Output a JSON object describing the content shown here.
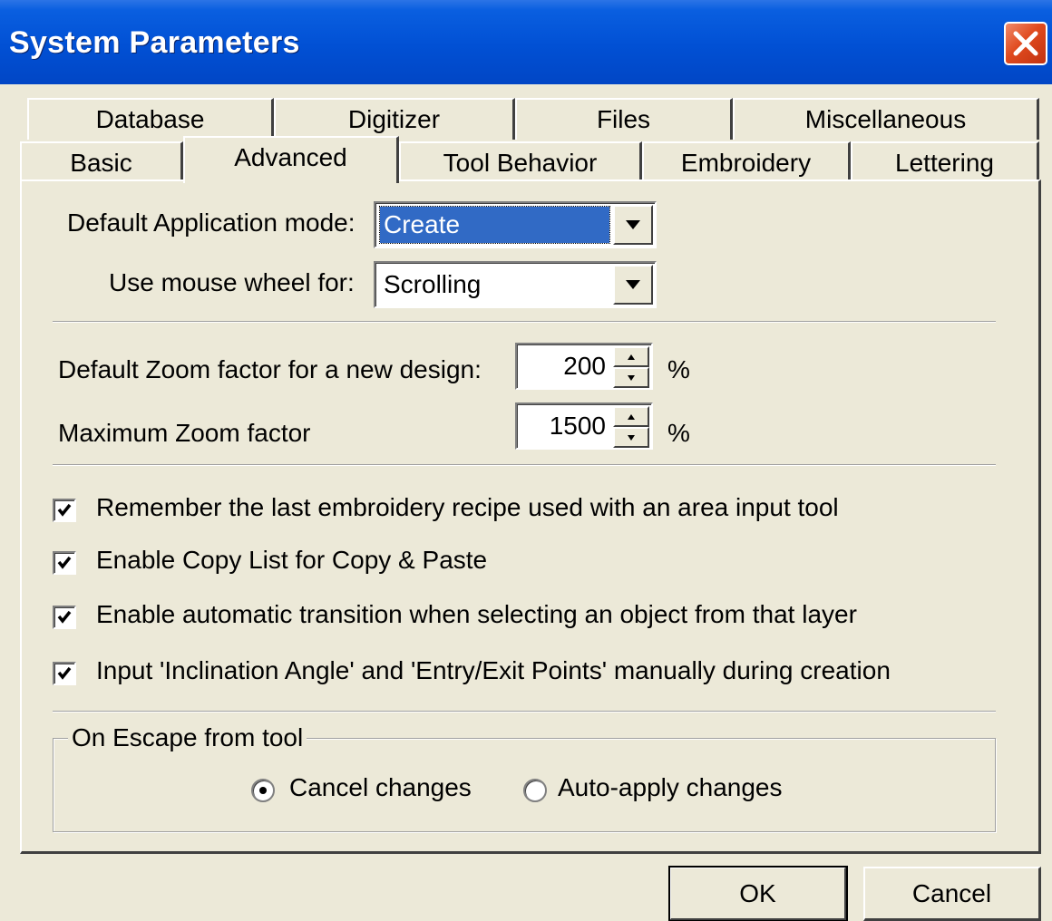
{
  "window": {
    "title": "System Parameters"
  },
  "tabs_back": [
    {
      "label": "Database"
    },
    {
      "label": "Digitizer"
    },
    {
      "label": "Files"
    },
    {
      "label": "Miscellaneous"
    }
  ],
  "tabs_front": [
    {
      "label": "Basic"
    },
    {
      "label": "Advanced",
      "selected": true
    },
    {
      "label": "Tool Behavior"
    },
    {
      "label": "Embroidery"
    },
    {
      "label": "Lettering"
    }
  ],
  "mode": {
    "label": "Default Application mode:",
    "value": "Create"
  },
  "wheel": {
    "label": "Use mouse wheel for:",
    "value": "Scrolling"
  },
  "zoom_default": {
    "label": "Default Zoom factor for a new design:",
    "value": "200",
    "unit": "%"
  },
  "zoom_max": {
    "label": "Maximum Zoom factor",
    "value": "1500",
    "unit": "%"
  },
  "checkboxes": [
    {
      "label": "Remember the last embroidery recipe used with an area input tool",
      "checked": true
    },
    {
      "label": "Enable Copy List for Copy & Paste",
      "checked": true
    },
    {
      "label": "Enable automatic transition when selecting an object from that layer",
      "checked": true
    },
    {
      "label": "Input 'Inclination Angle' and 'Entry/Exit Points' manually during creation",
      "checked": true
    }
  ],
  "escape": {
    "title": "On Escape from tool",
    "options": [
      {
        "label": "Cancel changes",
        "selected": true
      },
      {
        "label": "Auto-apply changes",
        "selected": false
      }
    ]
  },
  "buttons": {
    "ok": "OK",
    "cancel": "Cancel"
  }
}
